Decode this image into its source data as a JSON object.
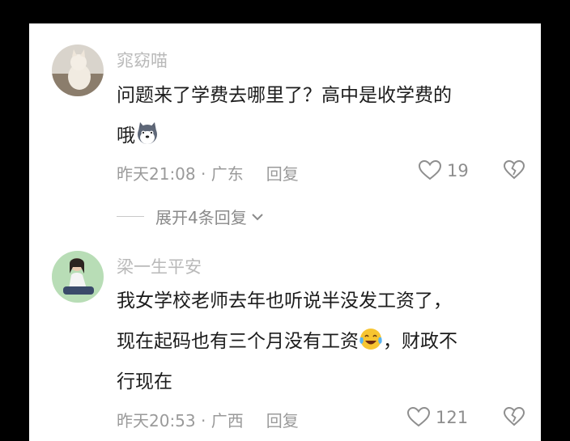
{
  "comments": [
    {
      "username": "窕窈喵",
      "text_line1": "问题来了学费去哪里了？高中是收学费的",
      "text_line2": "哦",
      "emoji": "husky-dog-emoji",
      "time": "昨天21:08",
      "location": "广东",
      "reply_label": "回复",
      "likes": "19",
      "expand_label": "展开4条回复"
    },
    {
      "username": "梁一生平安",
      "text_line1": "我女学校老师去年也听说半没发工资了，",
      "text_line2a": "现在起码也有三个月没有工资",
      "text_line2b": "，财政不",
      "text_line3": "行现在",
      "emoji": "laughing-tears-emoji",
      "time": "昨天20:53",
      "location": "广西",
      "reply_label": "回复",
      "likes": "121"
    }
  ],
  "separator": " · "
}
